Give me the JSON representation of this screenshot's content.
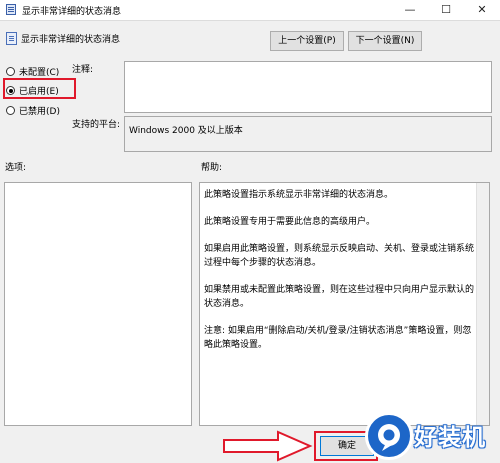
{
  "window": {
    "title": "显示非常详细的状态消息",
    "controls": {
      "minimize": "—",
      "maximize": "☐",
      "close": "✕"
    }
  },
  "header": {
    "policy_name": "显示非常详细的状态消息",
    "prev_button": "上一个设置(P)",
    "next_button": "下一个设置(N)"
  },
  "state_options": [
    {
      "label": "未配置(C)",
      "selected": false
    },
    {
      "label": "已启用(E)",
      "selected": true
    },
    {
      "label": "已禁用(D)",
      "selected": false
    }
  ],
  "comment": {
    "label": "注释:",
    "value": ""
  },
  "platform": {
    "label": "支持的平台:",
    "value": "Windows 2000 及以上版本"
  },
  "options": {
    "label": "选项:"
  },
  "help": {
    "label": "帮助:",
    "paragraphs": [
      "此策略设置指示系统显示非常详细的状态消息。",
      "此策略设置专用于需要此信息的高级用户。",
      "如果启用此策略设置，则系统显示反映启动、关机、登录或注销系统过程中每个步骤的状态消息。",
      "如果禁用或未配置此策略设置，则在这些过程中只向用户显示默认的状态消息。",
      "注意: 如果启用“删除启动/关机/登录/注销状态消息”策略设置，则忽略此策略设置。"
    ]
  },
  "footer": {
    "ok_button": "确定"
  },
  "watermark": {
    "text": "好装机"
  },
  "colors": {
    "highlight": "#e0192b",
    "watermark": "#1d66c8"
  }
}
